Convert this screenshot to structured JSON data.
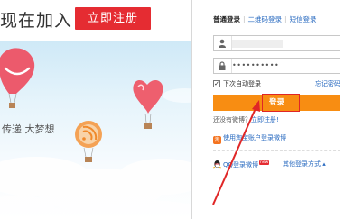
{
  "banner": {
    "join_text": "现在加入",
    "register_button": "立即注册"
  },
  "sky": {
    "slogan": "传递  大梦想"
  },
  "login": {
    "tabs": [
      {
        "label": "普通登录",
        "active": true
      },
      {
        "label": "二维码登录",
        "active": false
      },
      {
        "label": "短信登录",
        "active": false
      }
    ],
    "username_value": "",
    "password_value": "••••••••••",
    "remember_label": "下次自动登录",
    "remember_checked": true,
    "forgot_link": "忘记密码",
    "login_button": "登录",
    "no_account_text": "还没有微博？",
    "register_link": "立即注册!",
    "taobao_link": "使用淘宝账户登录微博",
    "qq_link": "QQ登录微博",
    "qq_badge": "new",
    "other_login": "其他登录方式 ▴"
  },
  "colors": {
    "accent_red": "#e52c32",
    "login_orange": "#f88d12",
    "link_blue": "#2a6bc0",
    "annotation_red": "#e02626"
  },
  "icons": [
    "user-icon",
    "lock-icon",
    "taobao-icon",
    "qq-icon",
    "annotation-arrow"
  ]
}
